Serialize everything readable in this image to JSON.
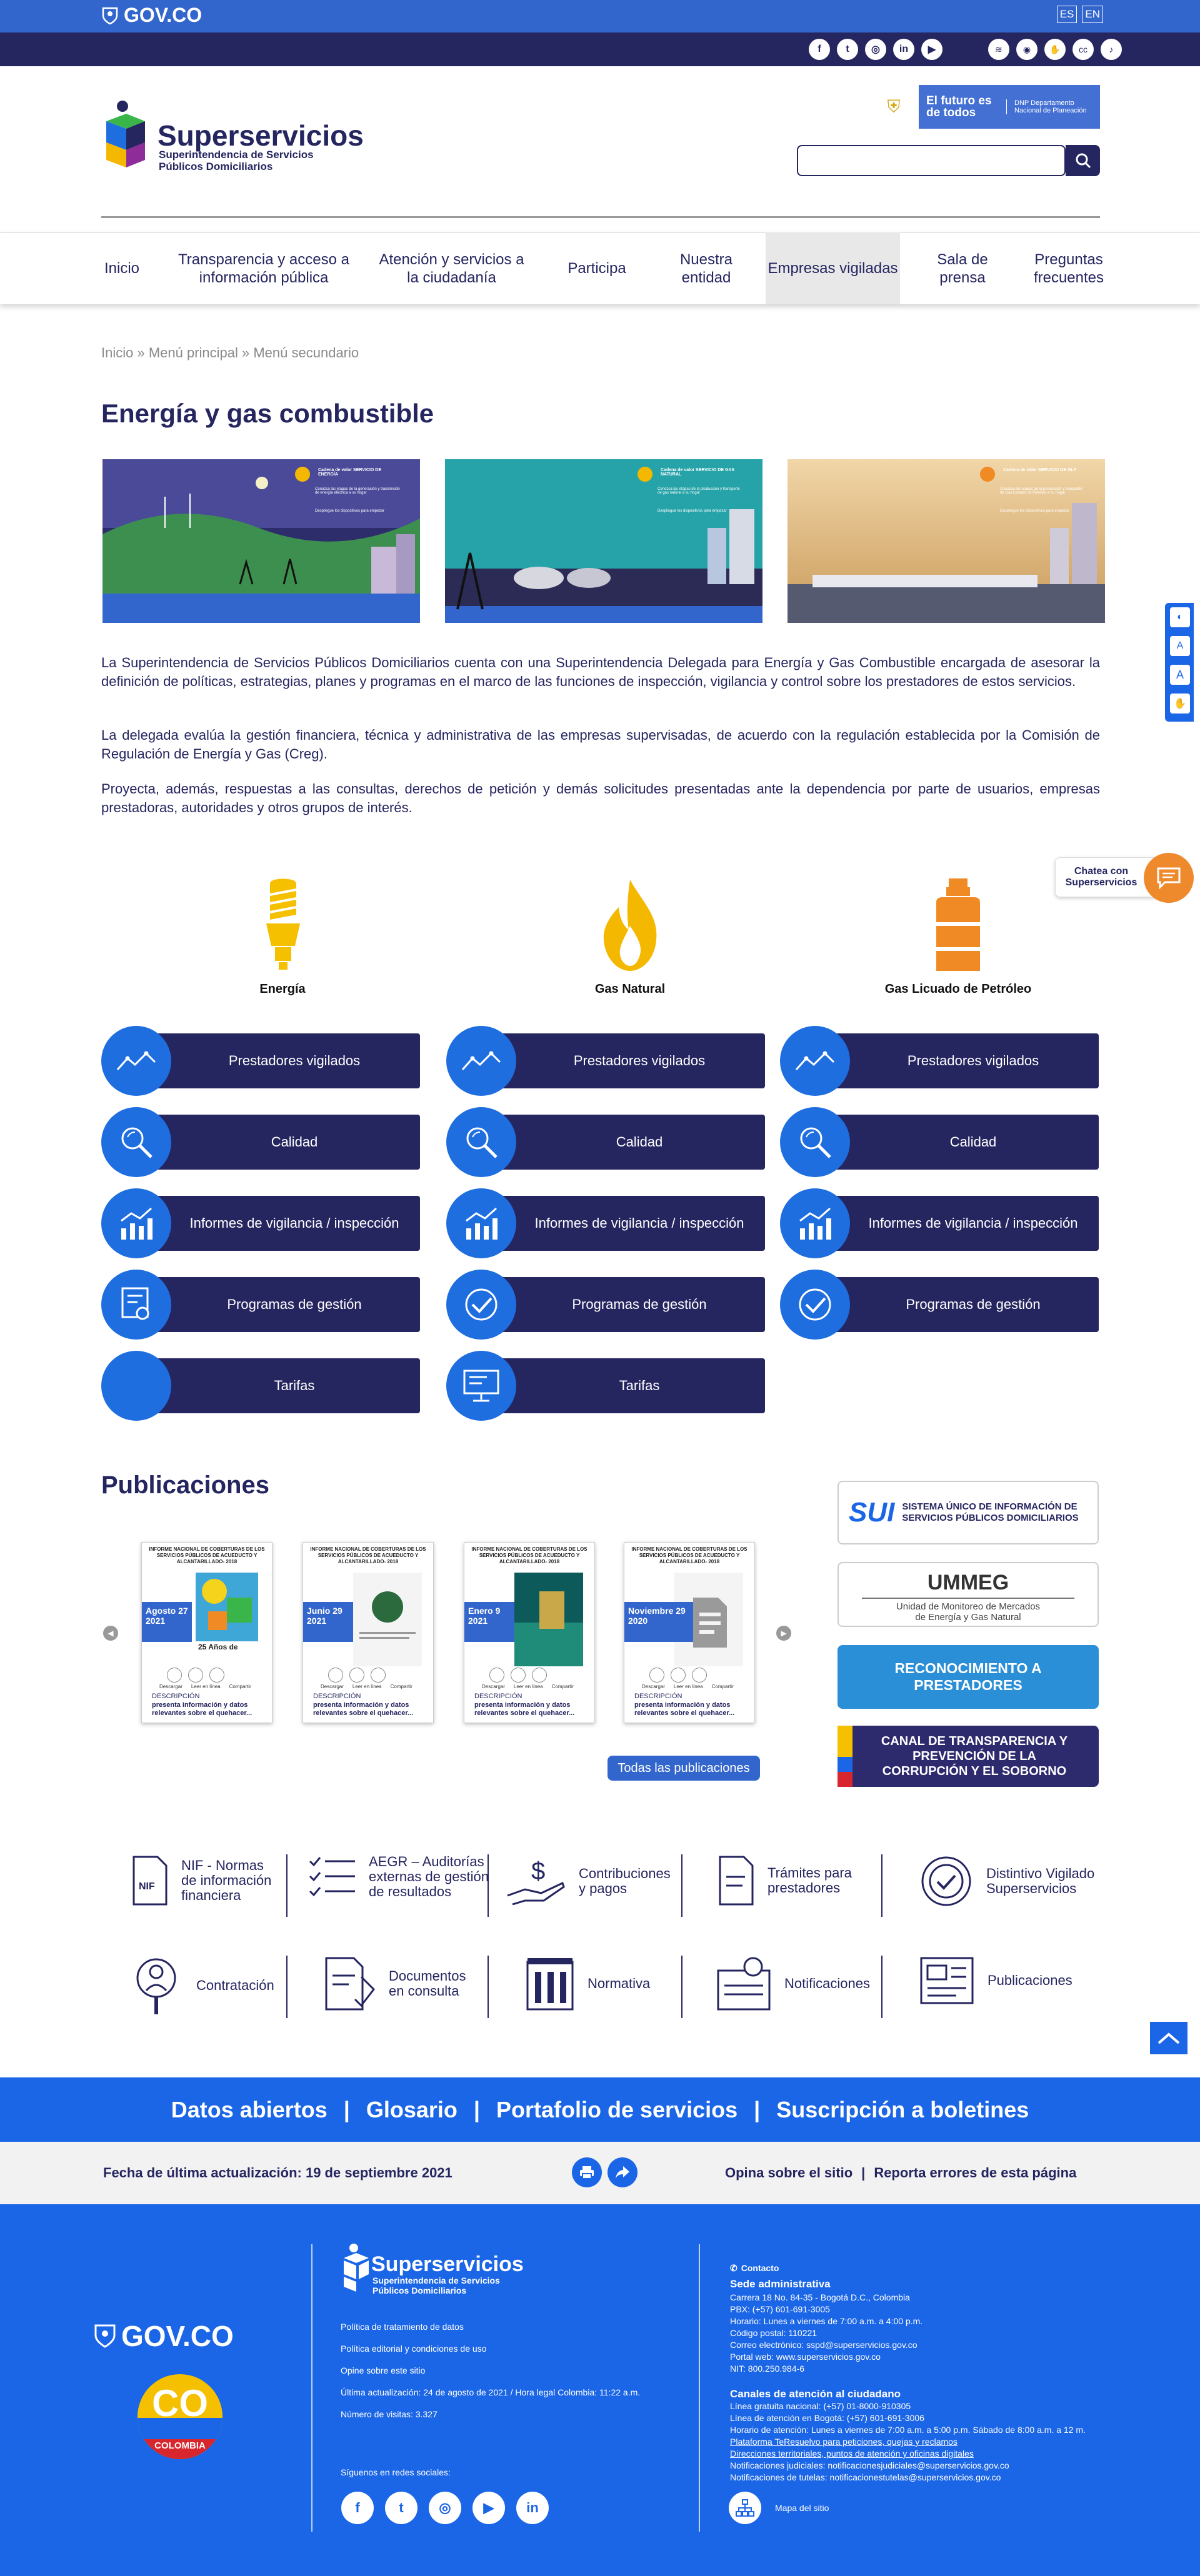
{
  "gov_bar": {
    "logo": "GOV.CO",
    "lang_es": "ES",
    "lang_en": "EN"
  },
  "social_top": [
    "facebook-icon",
    "twitter-icon",
    "instagram-icon",
    "linkedin-icon",
    "youtube-icon"
  ],
  "accessibility_top": [
    "wifi-icon",
    "eye-icon",
    "sign-language-icon",
    "cc-icon",
    "audio-icon"
  ],
  "header": {
    "title": "Superservicios",
    "subtitle_1": "Superintendencia de Servicios",
    "subtitle_2": "Públicos Domiciliarios",
    "dnp_title": "El futuro es de todos",
    "dnp_sub": "DNP Departamento Nacional de Planeación",
    "search_placeholder": ""
  },
  "nav": [
    {
      "label": "Inicio"
    },
    {
      "label": "Transparencia y acceso a información pública"
    },
    {
      "label": "Atención y servicios a la ciudadanía"
    },
    {
      "label": "Participa"
    },
    {
      "label": "Nuestra entidad"
    },
    {
      "label": "Empresas vigiladas"
    },
    {
      "label": "Sala de prensa"
    },
    {
      "label": "Preguntas frecuentes"
    }
  ],
  "breadcrumb": "Inicio » Menú principal » Menú secundario",
  "page_title": "Energía y gas combustible",
  "banners": [
    {
      "title": "Cadena de valor SERVICIO DE ENERGÍA",
      "text": "Conozca las etapas de la generación y transmisión de energía eléctrica a su hogar",
      "caption": "Despliegue los dispositivos para empezar"
    },
    {
      "title": "Cadena de valor SERVICIO DE GAS NATURAL",
      "text": "Conozca las etapas de la producción y transporte de gas natural a su hogar",
      "caption": "Despliegue los dispositivos para empezar"
    },
    {
      "title": "Cadena de valor SERVICIO DE GLP",
      "text": "Conozca las etapas de la producción y transporte de Gas Licuado de Petróleo a su hogar",
      "caption": "Despliegue los dispositivos para empezar"
    }
  ],
  "paragraphs": [
    "La Superintendencia de Servicios Públicos Domiciliarios cuenta con una Superintendencia Delegada para Energía y Gas Combustible encargada de asesorar la definición de políticas, estrategias, planes y programas en el marco de las funciones de inspección, vigilancia y control sobre los prestadores de estos servicios.",
    "La delegada evalúa la gestión financiera, técnica y administrativa de las empresas supervisadas, de acuerdo con la regulación establecida por la Comisión de Regulación de Energía y Gas (Creg).",
    "Proyecta, además, respuestas a las consultas, derechos de petición y demás solicitudes presentadas ante la dependencia por parte de usuarios, empresas prestadoras, autoridades y otros grupos de interés."
  ],
  "chat": {
    "label": "Chatea con Superservicios"
  },
  "sectors": [
    {
      "label": "Energía",
      "icon": "lightbulb-icon",
      "color": "#f5c000"
    },
    {
      "label": "Gas Natural",
      "icon": "flame-icon",
      "color": "#f5b800"
    },
    {
      "label": "Gas Licuado de Petróleo",
      "icon": "gas-cylinder-icon",
      "color": "#f08a24"
    }
  ],
  "pills": {
    "col1": [
      {
        "label": "Prestadores vigilados",
        "icon": "trend-icon"
      },
      {
        "label": "Calidad",
        "icon": "magnifier-icon"
      },
      {
        "label": "Informes de vigilancia / inspección",
        "icon": "bar-chart-icon"
      },
      {
        "label": "Programas de gestión",
        "icon": "certificate-icon"
      },
      {
        "label": "Tarifas",
        "icon": ""
      }
    ],
    "col2": [
      {
        "label": "Prestadores vigilados",
        "icon": "trend-icon"
      },
      {
        "label": "Calidad",
        "icon": "magnifier-icon"
      },
      {
        "label": "Informes de vigilancia / inspección",
        "icon": "bar-chart-icon"
      },
      {
        "label": "Programas de gestión",
        "icon": "checkmark-icon"
      },
      {
        "label": "Tarifas",
        "icon": "monitor-icon"
      }
    ],
    "col3": [
      {
        "label": "Prestadores vigilados",
        "icon": "trend-icon"
      },
      {
        "label": "Calidad",
        "icon": "magnifier-icon"
      },
      {
        "label": "Informes de vigilancia / inspección",
        "icon": "bar-chart-icon"
      },
      {
        "label": "Programas de gestión",
        "icon": "checkmark-icon"
      }
    ]
  },
  "publications": {
    "title": "Publicaciones",
    "all_label": "Todas las publicaciones",
    "cards": [
      {
        "head": "INFORME NACIONAL DE COBERTURAS DE LOS SERVICIOS PÚBLICOS DE ACUEDUCTO Y ALCANTARILLADO- 2018",
        "date": "Agosto 27 2021",
        "desc_label": "DESCRIPCIÓN",
        "desc": "presenta información y datos relevantes sobre el quehacer...",
        "actions": [
          "Descargar",
          "Leer en línea",
          "Compartir"
        ]
      },
      {
        "head": "INFORME NACIONAL DE COBERTURAS DE LOS SERVICIOS PÚBLICOS DE ACUEDUCTO Y ALCANTARILLADO- 2018",
        "date": "Junio 29 2021",
        "desc_label": "DESCRIPCIÓN",
        "desc": "presenta información y datos relevantes sobre el quehacer...",
        "actions": [
          "Descargar",
          "Leer en línea",
          "Compartir"
        ]
      },
      {
        "head": "INFORME NACIONAL DE COBERTURAS DE LOS SERVICIOS PÚBLICOS DE ACUEDUCTO Y ALCANTARILLADO- 2018",
        "date": "Enero 9 2021",
        "desc_label": "DESCRIPCIÓN",
        "desc": "presenta información y datos relevantes sobre el quehacer...",
        "actions": [
          "Descargar",
          "Leer en línea",
          "Compartir"
        ]
      },
      {
        "head": "INFORME NACIONAL DE COBERTURAS DE LOS SERVICIOS PÚBLICOS DE ACUEDUCTO Y ALCANTARILLADO- 2018",
        "date": "Noviembre 29 2020",
        "desc_label": "DESCRIPCIÓN",
        "desc": "presenta información y datos relevantes sobre el quehacer...",
        "actions": [
          "Descargar",
          "Leer en línea",
          "Compartir"
        ]
      }
    ],
    "card1_badge": "25 Años de"
  },
  "side_links": {
    "sui_line1": "SISTEMA ÚNICO DE INFORMACIÓN DE",
    "sui_line2": "SERVICIOS PÚBLICOS DOMICILIARIOS",
    "ummeg_title": "UMMEG",
    "ummeg_sub1": "Unidad de Monitoreo de Mercados",
    "ummeg_sub2": "de Energía y Gas Natural",
    "recon": "RECONOCIMIENTO A PRESTADORES",
    "canal": "CANAL DE TRANSPARENCIA Y PREVENCIÓN DE LA CORRUPCIÓN Y EL SOBORNO"
  },
  "services_row1": [
    {
      "label": "NIF - Normas de información financiera",
      "icon": "nif-doc-icon"
    },
    {
      "label": "AEGR – Auditorías externas de gestión de resultados",
      "icon": "checklist-icon"
    },
    {
      "label": "Contribuciones y pagos",
      "icon": "hand-money-icon"
    },
    {
      "label": "Trámites para prestadores",
      "icon": "document-icon"
    },
    {
      "label": "Distintivo Vigilado Superservicios",
      "icon": "seal-icon"
    }
  ],
  "services_row2": [
    {
      "label": "Contratación",
      "icon": "person-search-icon"
    },
    {
      "label": "Documentos en consulta",
      "icon": "doc-sign-icon"
    },
    {
      "label": "Normativa",
      "icon": "building-icon"
    },
    {
      "label": "Notificaciones",
      "icon": "bell-doc-icon"
    },
    {
      "label": "Publicaciones",
      "icon": "publications-icon"
    }
  ],
  "open_data_links": [
    "Datos abiertos",
    "Glosario",
    "Portafolio de servicios",
    "Suscripción a boletines"
  ],
  "update_bar": {
    "date_label": "Fecha de última actualización: 19 de septiembre 2021",
    "opina": "Opina sobre el sitio",
    "reporta": "Reporta errores de esta página"
  },
  "footer": {
    "govco": "GOV.CO",
    "co_label": "CO",
    "colombia": "COLOMBIA",
    "brand": "Superservicios",
    "brand_sub1": "Superintendencia de Servicios",
    "brand_sub2": "Públicos Domiciliarios",
    "links": [
      "Política de tratamiento de datos",
      "Política editorial y condiciones de uso",
      "Opine sobre este sitio",
      "Última actualización: 24 de agosto de 2021 / Hora legal Colombia: 11:22 a.m.",
      "Número de visitas: 3.327"
    ],
    "social_label": "Síguenos en redes sociales:",
    "contact_title": "Contacto",
    "sede_title": "Sede administrativa",
    "sede_lines": [
      "Carrera 18 No. 84-35 - Bogotá D.C., Colombia",
      "PBX: (+57) 601-691-3005",
      "Horario: Lunes a viernes de 7:00 a.m. a 4:00 p.m.",
      "Código postal: 110221",
      "Correo electrónico: sspd@superservicios.gov.co",
      "Portal web: www.superservicios.gov.co",
      "NIT: 800.250.984-6"
    ],
    "canales_title": "Canales de atención al ciudadano",
    "canales_lines": [
      "Línea gratuita nacional: (+57) 01-8000-910305",
      "Línea de atención en Bogotá: (+57) 601-691-3006",
      "Horario de atención: Lunes a viernes de 7:00 a.m. a 5:00 p.m. Sábado de 8:00 a.m. a 12 m.",
      "Plataforma TeResuelvo para peticiones, quejas y reclamos",
      "Direcciones territoriales, puntos de atención y oficinas digitales",
      "Notificaciones judiciales: notificacionesjudiciales@superservicios.gov.co",
      "Notificaciones de tutelas: notificacionestutelas@superservicios.gov.co"
    ],
    "mapa": "Mapa del sitio"
  },
  "colors": {
    "gov_blue": "#3366cc",
    "navy": "#252560",
    "bright_blue": "#1b66e6",
    "pill_circle": "#1e6ee0"
  }
}
